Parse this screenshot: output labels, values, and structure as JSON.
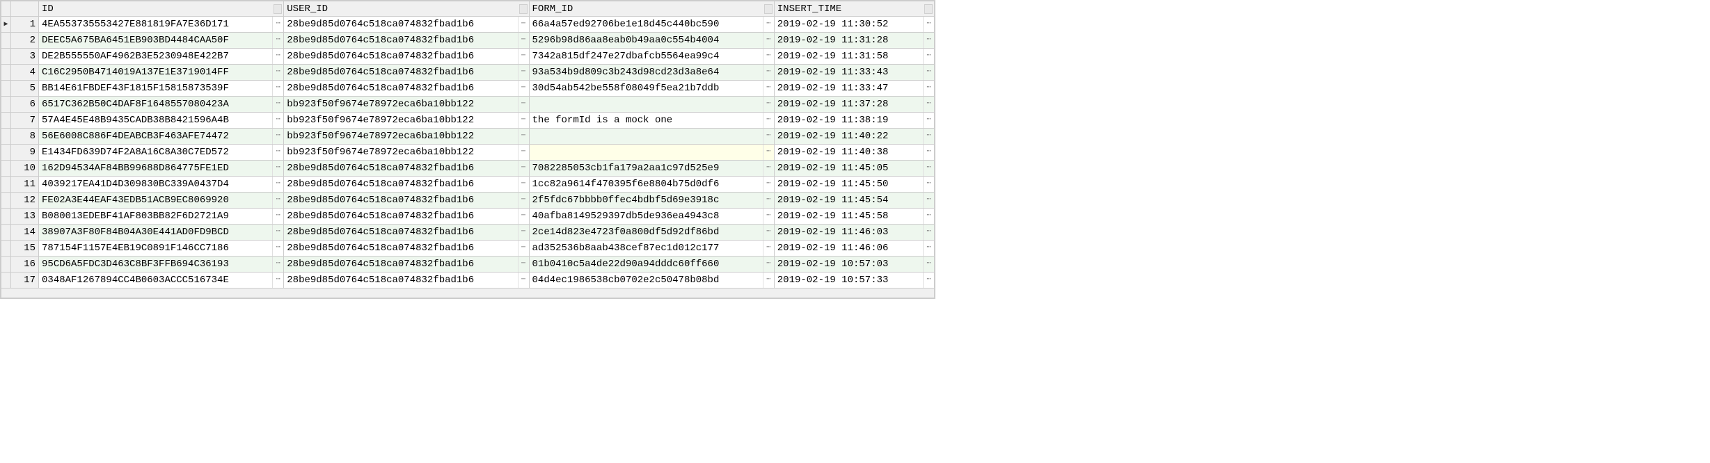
{
  "columns": {
    "id": "ID",
    "user_id": "USER_ID",
    "form_id": "FORM_ID",
    "insert_time": "INSERT_TIME"
  },
  "ellipsis_glyph": "⋯",
  "current_row_marker": "▶",
  "rows": [
    {
      "n": "1",
      "id": "4EA553735553427E881819FA7E36D171",
      "user_id": "28be9d85d0764c518ca074832fbad1b6",
      "form_id": "66a4a57ed92706be1e18d45c440bc590",
      "insert_time": "2019-02-19 11:30:52",
      "current": true
    },
    {
      "n": "2",
      "id": "DEEC5A675BA6451EB903BD4484CAA50F",
      "user_id": "28be9d85d0764c518ca074832fbad1b6",
      "form_id": "5296b98d86aa8eab0b49aa0c554b4004",
      "insert_time": "2019-02-19 11:31:28"
    },
    {
      "n": "3",
      "id": "DE2B555550AF4962B3E5230948E422B7",
      "user_id": "28be9d85d0764c518ca074832fbad1b6",
      "form_id": "7342a815df247e27dbafcb5564ea99c4",
      "insert_time": "2019-02-19 11:31:58"
    },
    {
      "n": "4",
      "id": "C16C2950B4714019A137E1E3719014FF",
      "user_id": "28be9d85d0764c518ca074832fbad1b6",
      "form_id": "93a534b9d809c3b243d98cd23d3a8e64",
      "insert_time": "2019-02-19 11:33:43"
    },
    {
      "n": "5",
      "id": "BB14E61FBDEF43F1815F15815873539F",
      "user_id": "28be9d85d0764c518ca074832fbad1b6",
      "form_id": "30d54ab542be558f08049f5ea21b7ddb",
      "insert_time": "2019-02-19 11:33:47"
    },
    {
      "n": "6",
      "id": "6517C362B50C4DAF8F1648557080423A",
      "user_id": "bb923f50f9674e78972eca6ba10bb122",
      "form_id": "",
      "insert_time": "2019-02-19 11:37:28",
      "form_empty": true
    },
    {
      "n": "7",
      "id": "57A4E45E48B9435CADB38B8421596A4B",
      "user_id": "bb923f50f9674e78972eca6ba10bb122",
      "form_id": "the formId is a mock one",
      "insert_time": "2019-02-19 11:38:19"
    },
    {
      "n": "8",
      "id": "56E6008C886F4DEABCB3F463AFE74472",
      "user_id": "bb923f50f9674e78972eca6ba10bb122",
      "form_id": "",
      "insert_time": "2019-02-19 11:40:22",
      "form_empty": true
    },
    {
      "n": "9",
      "id": "E1434FD639D74F2A8A16C8A30C7ED572",
      "user_id": "bb923f50f9674e78972eca6ba10bb122",
      "form_id": "",
      "insert_time": "2019-02-19 11:40:38",
      "form_empty": true
    },
    {
      "n": "10",
      "id": "162D94534AF84BB99688D864775FE1ED",
      "user_id": "28be9d85d0764c518ca074832fbad1b6",
      "form_id": "7082285053cb1fa179a2aa1c97d525e9",
      "insert_time": "2019-02-19 11:45:05"
    },
    {
      "n": "11",
      "id": "4039217EA41D4D309830BC339A0437D4",
      "user_id": "28be9d85d0764c518ca074832fbad1b6",
      "form_id": "1cc82a9614f470395f6e8804b75d0df6",
      "insert_time": "2019-02-19 11:45:50"
    },
    {
      "n": "12",
      "id": "FE02A3E44EAF43EDB51ACB9EC8069920",
      "user_id": "28be9d85d0764c518ca074832fbad1b6",
      "form_id": "2f5fdc67bbbb0ffec4bdbf5d69e3918c",
      "insert_time": "2019-02-19 11:45:54"
    },
    {
      "n": "13",
      "id": "B080013EDEBF41AF803BB82F6D2721A9",
      "user_id": "28be9d85d0764c518ca074832fbad1b6",
      "form_id": "40afba8149529397db5de936ea4943c8",
      "insert_time": "2019-02-19 11:45:58"
    },
    {
      "n": "14",
      "id": "38907A3F80F84B04A30E441AD0FD9BCD",
      "user_id": "28be9d85d0764c518ca074832fbad1b6",
      "form_id": "2ce14d823e4723f0a800df5d92df86bd",
      "insert_time": "2019-02-19 11:46:03"
    },
    {
      "n": "15",
      "id": "787154F1157E4EB19C0891F146CC7186",
      "user_id": "28be9d85d0764c518ca074832fbad1b6",
      "form_id": "ad352536b8aab438cef87ec1d012c177",
      "insert_time": "2019-02-19 11:46:06"
    },
    {
      "n": "16",
      "id": "95CD6A5FDC3D463C8BF3FFB694C36193",
      "user_id": "28be9d85d0764c518ca074832fbad1b6",
      "form_id": "01b0410c5a4de22d90a94dddc60ff660",
      "insert_time": "2019-02-19 10:57:03"
    },
    {
      "n": "17",
      "id": "0348AF1267894CC4B0603ACCC516734E",
      "user_id": "28be9d85d0764c518ca074832fbad1b6",
      "form_id": "04d4ec1986538cb0702e2c50478b08bd",
      "insert_time": "2019-02-19 10:57:33"
    }
  ]
}
